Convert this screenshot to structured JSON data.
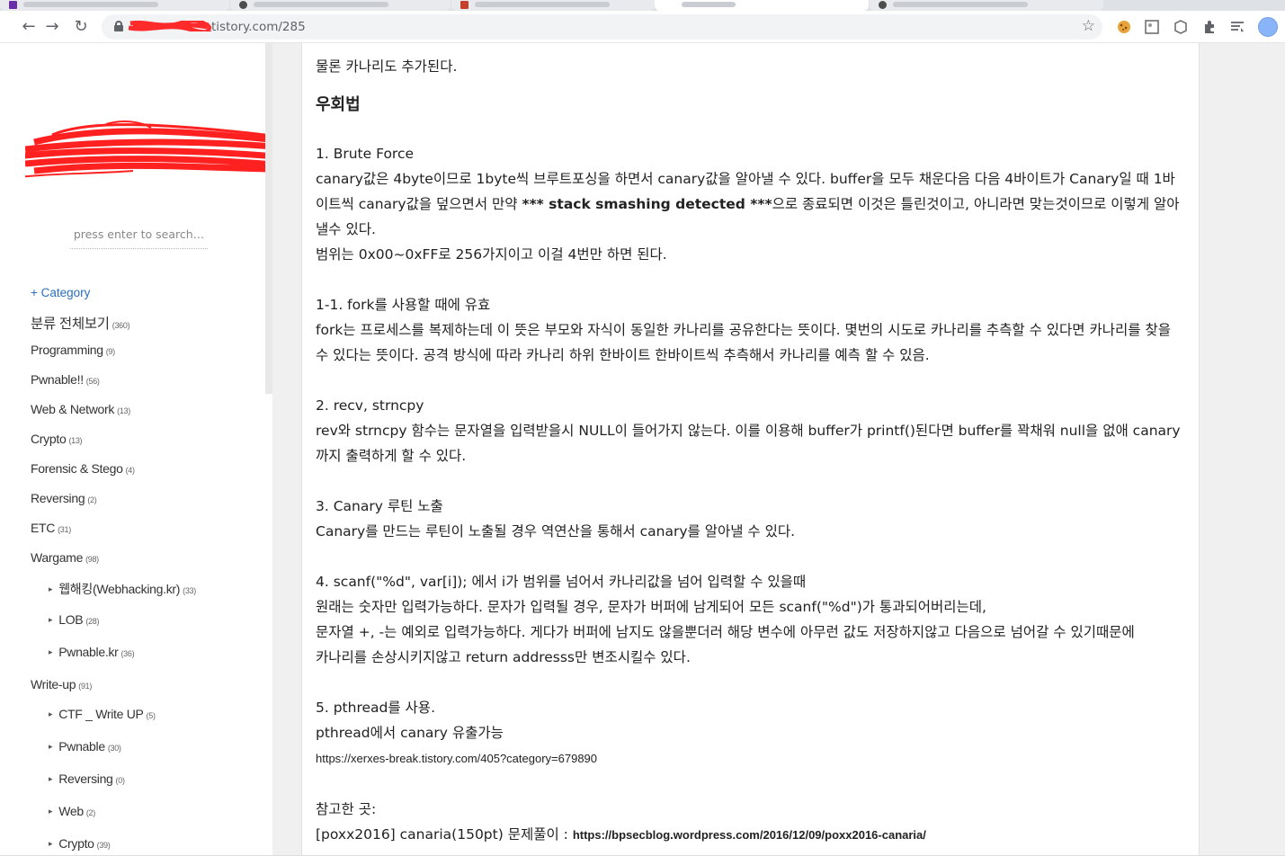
{
  "browser": {
    "url_visible": "tistory.com/285",
    "url_prefix_redacted": true
  },
  "sidebar": {
    "search_placeholder": "press enter to search…",
    "category_header": "+ Category",
    "categories": [
      {
        "label": "분류 전체보기",
        "count": "(360)",
        "level": "root"
      },
      {
        "label": "Programming",
        "count": "(9)",
        "level": "top"
      },
      {
        "label": "Pwnable!!",
        "count": "(56)",
        "level": "top"
      },
      {
        "label": "Web & Network",
        "count": "(13)",
        "level": "top"
      },
      {
        "label": "Crypto",
        "count": "(13)",
        "level": "top"
      },
      {
        "label": "Forensic & Stego",
        "count": "(4)",
        "level": "top"
      },
      {
        "label": "Reversing",
        "count": "(2)",
        "level": "top"
      },
      {
        "label": "ETC",
        "count": "(31)",
        "level": "top"
      },
      {
        "label": "Wargame",
        "count": "(98)",
        "level": "top"
      },
      {
        "label": "웹해킹(Webhacking.kr)",
        "count": "(33)",
        "level": "sub"
      },
      {
        "label": "LOB",
        "count": "(28)",
        "level": "sub"
      },
      {
        "label": "Pwnable.kr",
        "count": "(36)",
        "level": "sub"
      },
      {
        "label": "Write-up",
        "count": "(91)",
        "level": "top"
      },
      {
        "label": "CTF _ Write UP",
        "count": "(5)",
        "level": "sub"
      },
      {
        "label": "Pwnable",
        "count": "(30)",
        "level": "sub"
      },
      {
        "label": "Reversing",
        "count": "(0)",
        "level": "sub"
      },
      {
        "label": "Web",
        "count": "(2)",
        "level": "sub"
      },
      {
        "label": "Crypto",
        "count": "(39)",
        "level": "sub"
      }
    ]
  },
  "article": {
    "intro": "물론 카나리도 추가된다.",
    "heading": "우회법",
    "s1_title": "1. Brute Force",
    "s1_p1_a": "canary값은 4byte이므로 1byte씩 브루트포싱을 하면서 canary값을 알아낼 수 있다. buffer을 모두 채운다음 다음 4바이트가 Canary일 때 1바이트씩 canary값을 덮으면서 만약 ",
    "s1_p1_bold": "*** stack smashing detected ***",
    "s1_p1_b": "으로 종료되면 이것은 틀린것이고, 아니라면 맞는것이므로 이렇게 알아낼수 있다.",
    "s1_p2": "범위는 0x00~0xFF로 256가지이고 이걸 4번만 하면 된다.",
    "s11_title": "1-1. fork를 사용할 때에 유효",
    "s11_p": "fork는 프로세스를 복제하는데 이 뜻은 부모와 자식이 동일한 카나리를 공유한다는 뜻이다. 몇번의 시도로 카나리를 추측할 수 있다면 카나리를 찾을 수 있다는 뜻이다. 공격 방식에 따라 카나리 하위 한바이트 한바이트씩 추측해서 카나리를 예측 할 수 있음.",
    "s2_title": "2. recv, strncpy",
    "s2_p": "rev와 strncpy 함수는 문자열을 입력받을시 NULL이 들어가지 않는다. 이를 이용해 buffer가 printf()된다면 buffer를 꽉채워 null을 없애 canary까지 출력하게 할 수 있다.",
    "s3_title": "3. Canary 루틴 노출",
    "s3_p": "Canary를 만드는 루틴이 노출될 경우 역연산을 통해서 canary를 알아낼 수 있다.",
    "s4_title": "4. scanf(\"%d\", var[i]); 에서 i가 범위를 넘어서 카나리값을 넘어 입력할 수 있을때",
    "s4_p1": "원래는 숫자만 입력가능하다. 문자가 입력될 경우, 문자가 버퍼에 남게되어 모든 scanf(\"%d\")가 통과되어버리는데,",
    "s4_p2": "문자열 +, -는 예외로 입력가능하다. 게다가 버퍼에 남지도 않을뿐더러 해당 변수에 아무런 값도 저장하지않고 다음으로 넘어갈 수 있기때문에",
    "s4_p3": "카나리를 손상시키지않고 return addresss만 변조시킬수 있다.",
    "s5_title": "5. pthread를 사용.",
    "s5_p": "pthread에서 canary 유출가능",
    "s5_link": "https://xerxes-break.tistory.com/405?category=679890",
    "ref_title": "참고한 곳:",
    "ref_text": "[poxx2016] canaria(150pt) 문제풀이 : ",
    "ref_link": "https://bpsecblog.wordpress.com/2016/12/09/poxx2016-canaria/"
  }
}
